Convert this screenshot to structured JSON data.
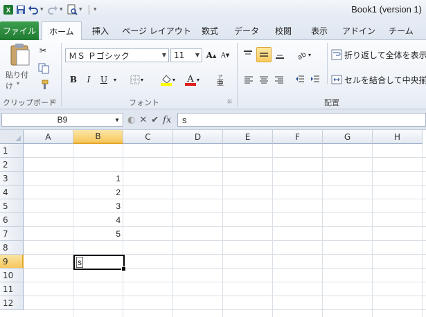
{
  "window": {
    "title": "Book1 (version 1)"
  },
  "tabs": {
    "file": "ファイル",
    "items": [
      "ホーム",
      "挿入",
      "ページ レイアウト",
      "数式",
      "データ",
      "校閲",
      "表示",
      "アドイン",
      "チーム"
    ]
  },
  "ribbon": {
    "clipboard": {
      "paste": "貼り付け",
      "label": "クリップボード"
    },
    "font": {
      "name": "ＭＳ Ｐゴシック",
      "size": "11",
      "label": "フォント",
      "bold": "B",
      "italic": "I",
      "underline": "U"
    },
    "alignment": {
      "wrap": "折り返して全体を表示す",
      "merge": "セルを結合して中央揃え",
      "label": "配置"
    }
  },
  "formula_bar": {
    "name_box": "B9",
    "fx": "fx",
    "value": "s"
  },
  "grid": {
    "columns": [
      "A",
      "B",
      "C",
      "D",
      "E",
      "F",
      "G",
      "H"
    ],
    "rows": [
      "1",
      "2",
      "3",
      "4",
      "5",
      "6",
      "7",
      "8",
      "9",
      "10",
      "11",
      "12"
    ],
    "values": [
      {
        "row": 3,
        "col": "B",
        "v": "1"
      },
      {
        "row": 4,
        "col": "B",
        "v": "2"
      },
      {
        "row": 5,
        "col": "B",
        "v": "3"
      },
      {
        "row": 6,
        "col": "B",
        "v": "4"
      },
      {
        "row": 7,
        "col": "B",
        "v": "5"
      }
    ],
    "active_cell_text": "s"
  }
}
